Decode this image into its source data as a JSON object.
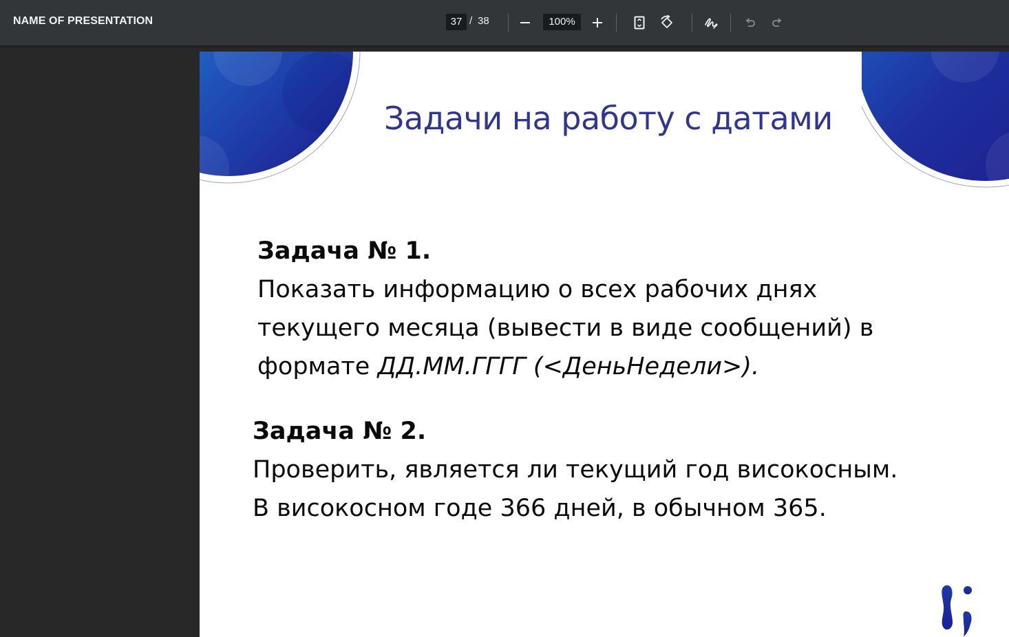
{
  "toolbar": {
    "title": "NAME OF PRESENTATION",
    "page_current": "37",
    "page_separator": "/",
    "page_total": "38",
    "zoom": "100%",
    "icons": {
      "zoom_out": "minus-icon",
      "zoom_in": "plus-icon",
      "fit_page": "fit-page-icon",
      "rotate": "rotate-icon",
      "draw": "draw-icon",
      "undo": "undo-icon",
      "redo": "redo-icon"
    }
  },
  "slide": {
    "title": "Задачи на работу с датами",
    "task1": {
      "heading": "Задача № 1.",
      "line1": "Показать информацию о всех рабочих днях",
      "line2": "текущего месяца (вывести в виде сообщений) в",
      "line3_prefix": "формате ",
      "line3_italic": "ДД.ММ.ГГГГ (<ДеньНедели>)."
    },
    "task2": {
      "heading": "Задача № 2.",
      "line1": "Проверить, является ли текущий год високосным.",
      "line2": "В високосном годе 366 дней, в обычном 365."
    },
    "colors": {
      "title": "#2e3592",
      "circle_light": "#2aa1e6",
      "circle_dark": "#1d1a8a"
    }
  }
}
